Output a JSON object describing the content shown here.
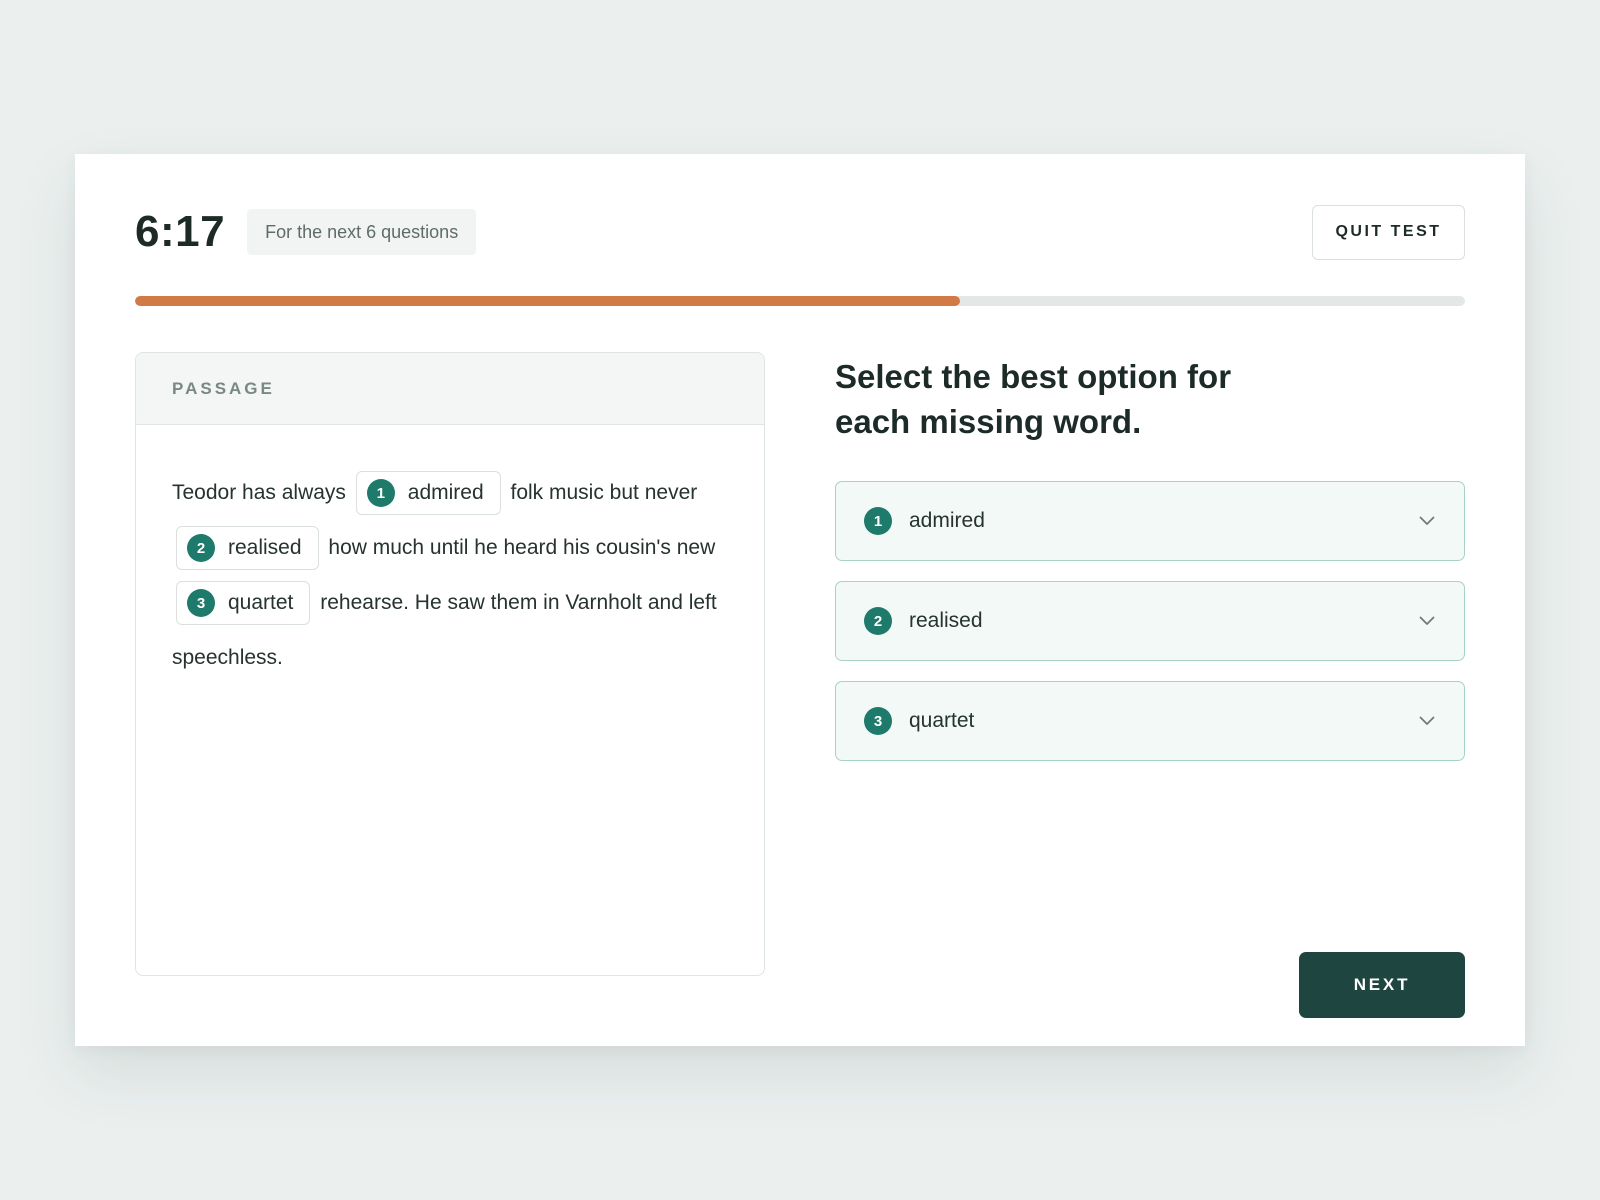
{
  "header": {
    "timer": "6:17",
    "timer_note": "For the next 6 questions",
    "quit_label": "QUIT TEST"
  },
  "progress": {
    "fraction": 0.62
  },
  "passage": {
    "heading": "PASSAGE",
    "text_1": "Teodor has always",
    "blank_1": {
      "num": "1",
      "word": "admired"
    },
    "text_2": "folk music but never",
    "blank_2": {
      "num": "2",
      "word": "realised"
    },
    "text_3": "how much until he heard his cousin's new",
    "blank_3": {
      "num": "3",
      "word": "quartet"
    },
    "text_4": "rehearse. He saw them in Varnholt and left speechless."
  },
  "question": {
    "title": "Select the best option for each missing word.",
    "options": [
      {
        "num": "1",
        "value": "admired",
        "icon": "chevron-down-icon"
      },
      {
        "num": "2",
        "value": "realised",
        "icon": "chevron-down-icon"
      },
      {
        "num": "3",
        "value": "quartet",
        "icon": "chevron-down-icon"
      }
    ],
    "next_label": "NEXT"
  },
  "colors": {
    "accent": "#1e7a6a",
    "progress": "#d27a45",
    "primary_button": "#1f4540"
  }
}
